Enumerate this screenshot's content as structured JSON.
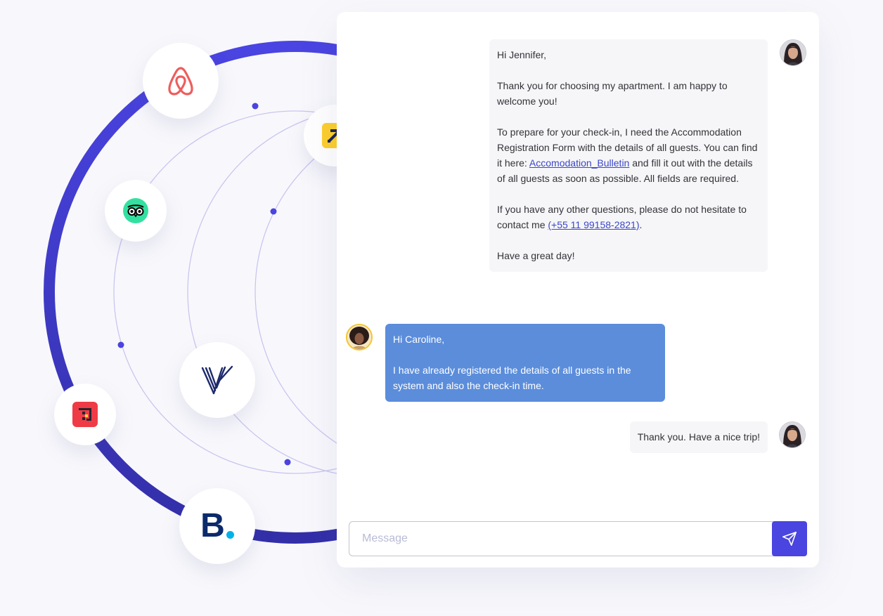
{
  "colors": {
    "accent": "#4a44e0",
    "orbit_thin": "#c9c5f0",
    "host_bubble": "#f6f6f8",
    "guest_bubble": "#5b8ddb",
    "link": "#3b46c8"
  },
  "platforms": [
    {
      "name": "Airbnb",
      "icon": "airbnb-icon"
    },
    {
      "name": "Expedia",
      "icon": "expedia-icon"
    },
    {
      "name": "Tripadvisor",
      "icon": "tripadvisor-icon"
    },
    {
      "name": "Vrbo",
      "icon": "vrbo-icon"
    },
    {
      "name": "Hostfully",
      "icon": "hostfully-icon"
    },
    {
      "name": "Booking.com",
      "icon": "booking-icon",
      "glyph": "B",
      "dot_color": "#00b1ea"
    }
  ],
  "chat": {
    "messages": [
      {
        "sender": "host",
        "avatar": "host-avatar",
        "paragraphs": [
          [
            {
              "text": "Hi Jennifer,"
            }
          ],
          [
            {
              "text": "Thank you for choosing my apartment. I am happy to welcome you!"
            }
          ],
          [
            {
              "text": "To prepare for your check-in, I need the Accommodation Registration Form with the details of all guests. You can find it here: "
            },
            {
              "text": "Accomodation_Bulletin",
              "link": true
            },
            {
              "text": " and fill it out with the details of all guests as soon as possible. All fields are required."
            }
          ],
          [
            {
              "text": "If you have any other questions, please do not hesitate to contact me "
            },
            {
              "text": "(+55 11 99158-2821)",
              "link": true
            },
            {
              "text": "."
            }
          ],
          [
            {
              "text": "Have a great day!"
            }
          ]
        ]
      },
      {
        "sender": "guest",
        "avatar": "guest-avatar",
        "paragraphs": [
          [
            {
              "text": "Hi Caroline,"
            }
          ],
          [
            {
              "text": "I have already registered the details of all guests in the system and also the check-in time."
            }
          ]
        ]
      },
      {
        "sender": "host",
        "avatar": "host-avatar",
        "paragraphs": [
          [
            {
              "text": "Thank you. Have a nice trip!"
            }
          ]
        ]
      }
    ],
    "input": {
      "value": "",
      "placeholder": "Message"
    },
    "send_icon": "send-icon"
  }
}
